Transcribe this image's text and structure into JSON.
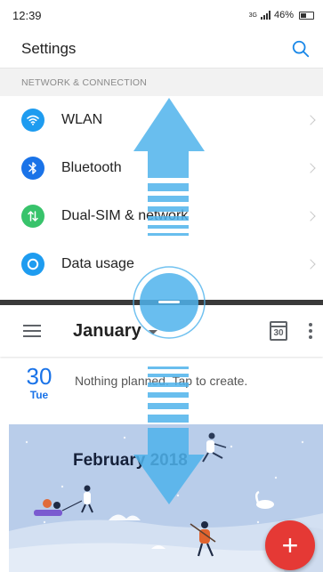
{
  "status_bar": {
    "time": "12:39",
    "network_type": "3G",
    "battery": "46%"
  },
  "settings": {
    "title": "Settings",
    "section_label": "NETWORK & CONNECTION",
    "items": [
      {
        "label": "WLAN",
        "icon": "wifi-icon",
        "color": "#1e9cf0"
      },
      {
        "label": "Bluetooth",
        "icon": "bluetooth-icon",
        "color": "#1a73e8"
      },
      {
        "label": "Dual-SIM & network",
        "icon": "dual-sim-icon",
        "color": "#38c36b"
      },
      {
        "label": "Data usage",
        "icon": "data-usage-icon",
        "color": "#1e9cf0"
      }
    ]
  },
  "calendar": {
    "month": "January",
    "today_number": "30",
    "day_number": "30",
    "weekday": "Tue",
    "empty_message": "Nothing planned. Tap to create.",
    "banner_title": "February 2018",
    "accent_color": "#1a73e8",
    "fab_color": "#e53935"
  },
  "gesture_overlay": {
    "color": "#4fb3ec"
  }
}
